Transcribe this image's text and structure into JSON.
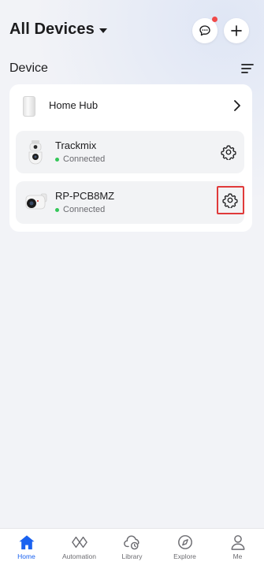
{
  "header": {
    "title": "All Devices",
    "caret_icon": "caret-down-icon",
    "message_icon": "chat-bubble-icon",
    "add_icon": "plus-icon",
    "has_notification": true
  },
  "section": {
    "title": "Device",
    "sort_icon": "sort-lines-icon"
  },
  "hub": {
    "label": "Home Hub",
    "icon": "home-hub-icon"
  },
  "devices": [
    {
      "name": "Trackmix",
      "status": "Connected",
      "icon": "ptz-camera-icon"
    },
    {
      "name": "RP-PCB8MZ",
      "status": "Connected",
      "icon": "bullet-camera-icon"
    }
  ],
  "tabs": [
    {
      "label": "Home",
      "icon": "home-icon",
      "active": true
    },
    {
      "label": "Automation",
      "icon": "automation-icon",
      "active": false
    },
    {
      "label": "Library",
      "icon": "cloud-library-icon",
      "active": false
    },
    {
      "label": "Explore",
      "icon": "compass-icon",
      "active": false
    },
    {
      "label": "Me",
      "icon": "person-icon",
      "active": false
    }
  ],
  "colors": {
    "accent": "#1a62f0",
    "status_online": "#34c759",
    "notification": "#f04a4a",
    "highlight": "#e03a3a"
  }
}
